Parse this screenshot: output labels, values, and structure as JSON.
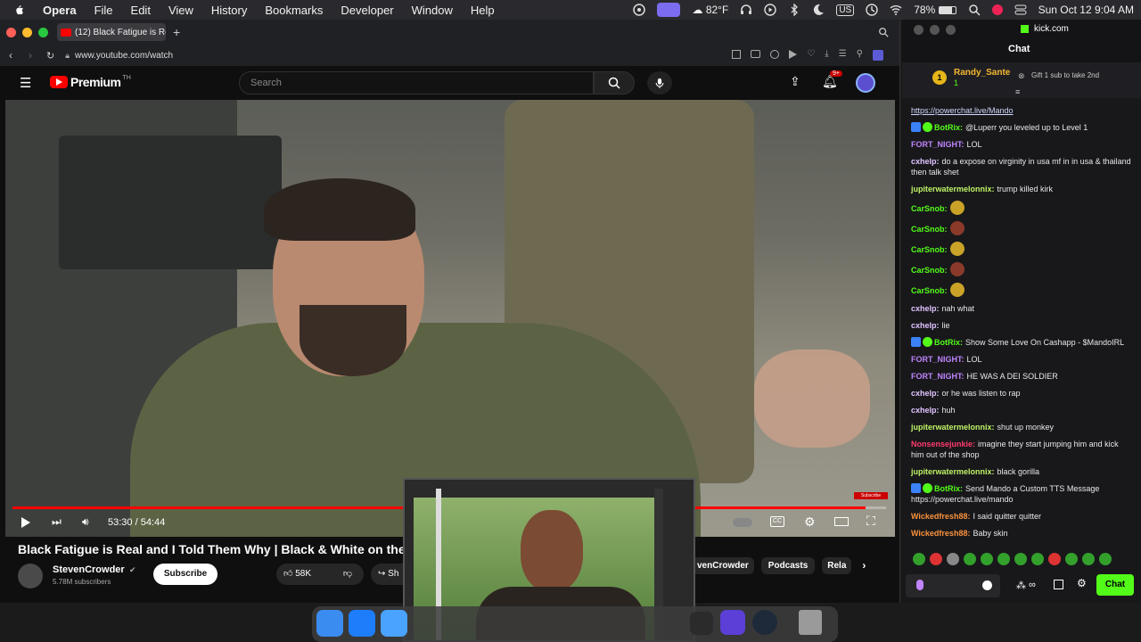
{
  "menubar": {
    "app": "Opera",
    "items": [
      "File",
      "Edit",
      "View",
      "History",
      "Bookmarks",
      "Developer",
      "Window",
      "Help"
    ],
    "weather": "82°F",
    "keyboard": "US",
    "battery": "78%",
    "datetime": "Sun Oct 12  9:04 AM"
  },
  "browser": {
    "tab_title": "(12) Black Fatigue is Re",
    "url": "www.youtube.com/watch"
  },
  "youtube": {
    "logo": "Premium",
    "logo_sup": "TH",
    "search_placeholder": "Search",
    "notif_count": "9+",
    "time": "53:30 / 54:44",
    "progress": 0.977,
    "title": "Black Fatigue is Real and I Told Them Why | Black & White on the",
    "channel": "StevenCrowder",
    "subs": "5.78M subscribers",
    "subscribe": "Subscribe",
    "likes": "58K",
    "share": "Sh",
    "chips": [
      "venCrowder",
      "Podcasts",
      "Rela"
    ],
    "subscribe_overlay": "Subscribe"
  },
  "chat": {
    "site": "kick.com",
    "header": "Chat",
    "pinned": {
      "user": "Randy_Sante",
      "count": "1",
      "gift": "Gift 1 sub to take 2nd"
    },
    "messages": [
      {
        "user": "",
        "text": "https://powerchat.live/Mando",
        "color": "#cfd8ff",
        "link": true
      },
      {
        "user": "BotRix:",
        "text": "@Luperr you leveled up to Level 1",
        "color": "#53fc18",
        "badges": 2
      },
      {
        "user": "FORT_NIGHT:",
        "text": "LOL",
        "color": "#c084fc"
      },
      {
        "user": "cxhelp:",
        "text": "do a expose on virginity in usa mf in in usa & thailand then talk shet",
        "color": "#e0c3ff"
      },
      {
        "user": "jupiterwatermelonnix:",
        "text": "trump killed kirk",
        "color": "#bef264"
      },
      {
        "user": "CarSnob:",
        "text": "",
        "color": "#53fc18",
        "emote": "y"
      },
      {
        "user": "CarSnob:",
        "text": "",
        "color": "#53fc18",
        "emote": "o"
      },
      {
        "user": "CarSnob:",
        "text": "",
        "color": "#53fc18",
        "emote": "y"
      },
      {
        "user": "CarSnob:",
        "text": "",
        "color": "#53fc18",
        "emote": "o"
      },
      {
        "user": "CarSnob:",
        "text": "",
        "color": "#53fc18",
        "emote": "y"
      },
      {
        "user": "cxhelp:",
        "text": "nah what",
        "color": "#e0c3ff"
      },
      {
        "user": "cxhelp:",
        "text": "lie",
        "color": "#e0c3ff"
      },
      {
        "user": "BotRix:",
        "text": "Show Some Love On Cashapp - $MandoIRL",
        "color": "#53fc18",
        "badges": 2
      },
      {
        "user": "FORT_NIGHT:",
        "text": "LOL",
        "color": "#c084fc"
      },
      {
        "user": "FORT_NIGHT:",
        "text": "HE WAS A DEI SOLDIER",
        "color": "#c084fc"
      },
      {
        "user": "cxhelp:",
        "text": "or he was listen to rap",
        "color": "#e0c3ff"
      },
      {
        "user": "cxhelp:",
        "text": "huh",
        "color": "#e0c3ff"
      },
      {
        "user": "jupiterwatermelonnix:",
        "text": "shut up monkey",
        "color": "#bef264"
      },
      {
        "user": "Nonsensejunkie:",
        "text": "imagine they start jumping him and kick him out of the shop",
        "color": "#ff3b6b"
      },
      {
        "user": "jupiterwatermelonnix:",
        "text": "black gorilla",
        "color": "#bef264"
      },
      {
        "user": "BotRix:",
        "text": "Send Mando a Custom TTS Message https://powerchat.live/mando",
        "color": "#53fc18",
        "badges": 2
      },
      {
        "user": "Wickedfresh88:",
        "text": "I said quitter quitter",
        "color": "#fb923c"
      },
      {
        "user": "Wickedfresh88:",
        "text": "Baby skin",
        "color": "#fb923c"
      }
    ],
    "send_label": "Chat"
  },
  "colors": {
    "accent": "#53fc18",
    "yt_red": "#ff0000"
  }
}
